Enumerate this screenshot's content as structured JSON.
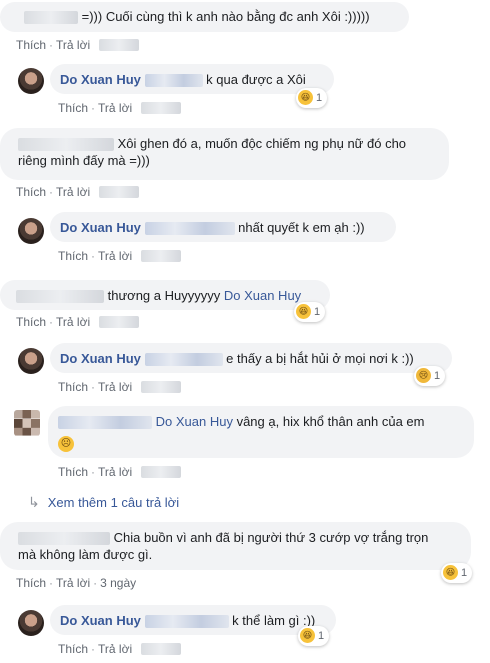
{
  "comments": [
    {
      "text": "=))) Cuối cùng thì k anh nào bằng đc anh Xôi :)))))"
    },
    {
      "name": "Do Xuan Huy",
      "text": "k qua được a Xôi",
      "reaction_count": "1"
    },
    {
      "text_line1": "Xôi ghen đó a, muốn độc chiếm ng phụ nữ đó cho",
      "text_line2": "riêng mình đấy mà =)))"
    },
    {
      "name": "Do Xuan Huy",
      "text": "nhất quyết k em ạh :))"
    },
    {
      "text": "thương a Huyyyyyy",
      "tag": "Do Xuan Huy",
      "reaction_count": "1"
    },
    {
      "name": "Do Xuan Huy",
      "text": "e thấy a bị hắt hủi ở mọi nơi k :))",
      "reaction_count": "1"
    },
    {
      "tag": "Do Xuan Huy",
      "text": "vâng ạ, hix khổ thân anh của em"
    },
    {
      "text_line1": "Chia buồn vì anh đã bị người thứ 3 cướp vợ trắng trọn",
      "text_line2": "mà không làm được gì.",
      "time": "3 ngày",
      "reaction_count": "1"
    },
    {
      "name": "Do Xuan Huy",
      "text": "k thể làm gì :))",
      "reaction_count": "1"
    }
  ],
  "actions": {
    "like": "Thích",
    "reply": "Trả lời",
    "separator": "·"
  },
  "see_more": "Xem thêm 1 câu trả lời",
  "colors": {
    "bubble": "#f2f3f5",
    "link": "#385898",
    "meta": "#616770"
  },
  "icons": {
    "haha": "haha-reaction-icon",
    "sad": "sad-reaction-icon",
    "reply_arrow": "reply-arrow-icon"
  }
}
